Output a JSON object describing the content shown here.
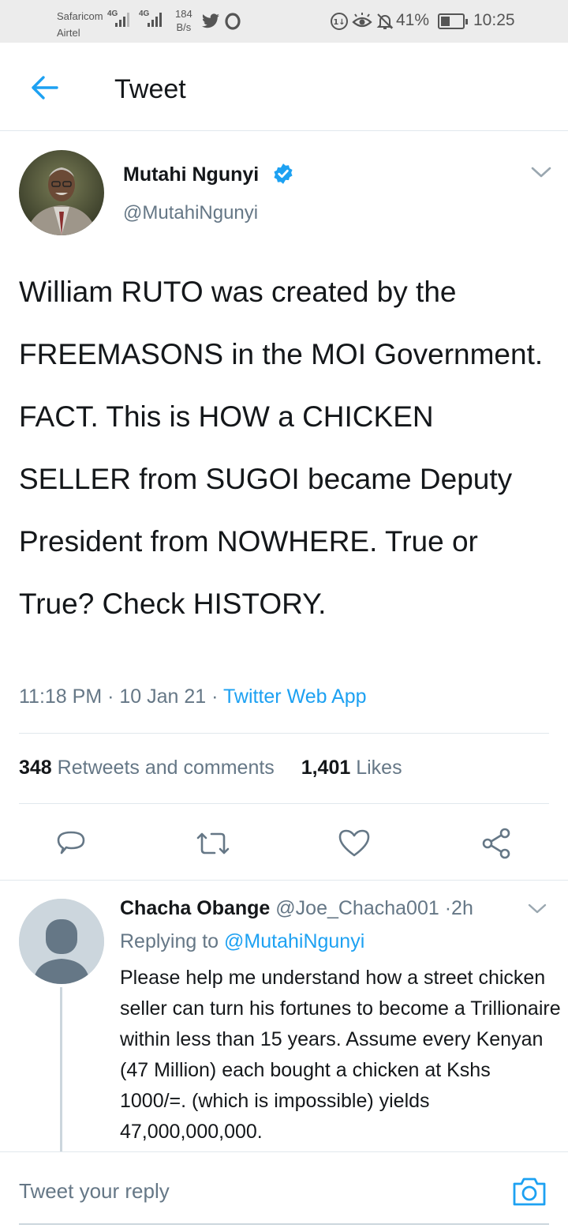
{
  "status_bar": {
    "carrier_1": "Safaricom",
    "carrier_2": "Airtel",
    "network_1": "4G",
    "network_2": "4G",
    "speed_value": "184",
    "speed_unit": "B/s",
    "battery_percent": "41%",
    "battery_level": 0.41,
    "time": "10:25",
    "icons": [
      "twitter-icon",
      "opera-icon",
      "data-saver-icon",
      "eye-comfort-icon",
      "mute-icon",
      "battery-icon"
    ]
  },
  "header": {
    "back_icon": "arrow-left-icon",
    "title": "Tweet"
  },
  "tweet": {
    "author_name": "Mutahi Ngunyi",
    "verified": true,
    "handle": "@MutahiNgunyi",
    "text": "William RUTO was created by the FREEMASONS in the MOI Government. FACT. This is HOW a CHICKEN SELLER from SUGOI became Deputy President from NOWHERE. True or True? Check HISTORY.",
    "time": "11:18 PM",
    "date": "10 Jan 21",
    "source": "Twitter Web App",
    "retweets_count": "348",
    "retweets_label": "Retweets and comments",
    "likes_count": "1,401",
    "likes_label": "Likes"
  },
  "actions": {
    "reply_icon": "comment-icon",
    "retweet_icon": "retweet-icon",
    "like_icon": "heart-icon",
    "share_icon": "share-icon"
  },
  "reply": {
    "author_name": "Chacha Obange",
    "handle": "@Joe_Chacha001",
    "age": "2h",
    "replying_label": "Replying to",
    "replying_to": "@MutahiNgunyi",
    "text": "Please help me understand how a street chicken seller can turn his fortunes to become a Trillionaire within less than 15 years. Assume every Kenyan (47 Million) each bought a chicken at Kshs 1000/=. (which is impossible) yields 47,000,000,000."
  },
  "compose": {
    "placeholder": "Tweet your reply",
    "camera_icon": "camera-icon"
  },
  "colors": {
    "accent": "#1da1f2",
    "text": "#14171a",
    "secondary_text": "#657786",
    "divider": "#e1e8ed",
    "status_bar_bg": "#ececec"
  }
}
